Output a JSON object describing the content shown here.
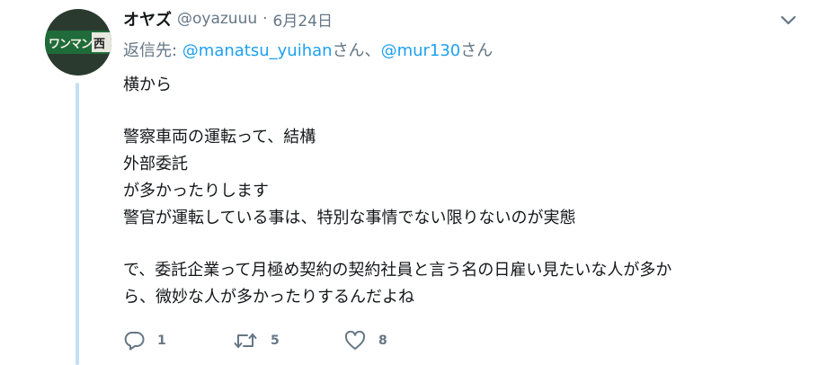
{
  "tweet": {
    "author_name": "オヤズ",
    "handle": "@oyazuuu",
    "separator": "·",
    "date": "6月24日",
    "avatar_text": "ワンマン",
    "avatar_text2": "西",
    "reply": {
      "prefix": "返信先: ",
      "mention1": "@manatsu_yuihan",
      "suffix1": "さん、",
      "mention2": "@mur130",
      "suffix2": "さん"
    },
    "lines": [
      "横から",
      "",
      "警察車両の運転って、結構",
      "外部委託",
      "が多かったりします",
      "警官が運転している事は、特別な事情でない限りないのが実態",
      "",
      "で、委託企業って月極め契約の契約社員と言う名の日雇い見たいな人が多か",
      "ら、微妙な人が多かったりするんだよね"
    ],
    "actions": {
      "reply_count": "1",
      "retweet_count": "5",
      "like_count": "8"
    }
  },
  "colors": {
    "text": "#14171a",
    "secondary": "#657786",
    "link": "#1da1f2",
    "thread": "#c4e0f5"
  },
  "icons": [
    "chevron-down-icon",
    "reply-icon",
    "retweet-icon",
    "like-icon"
  ]
}
